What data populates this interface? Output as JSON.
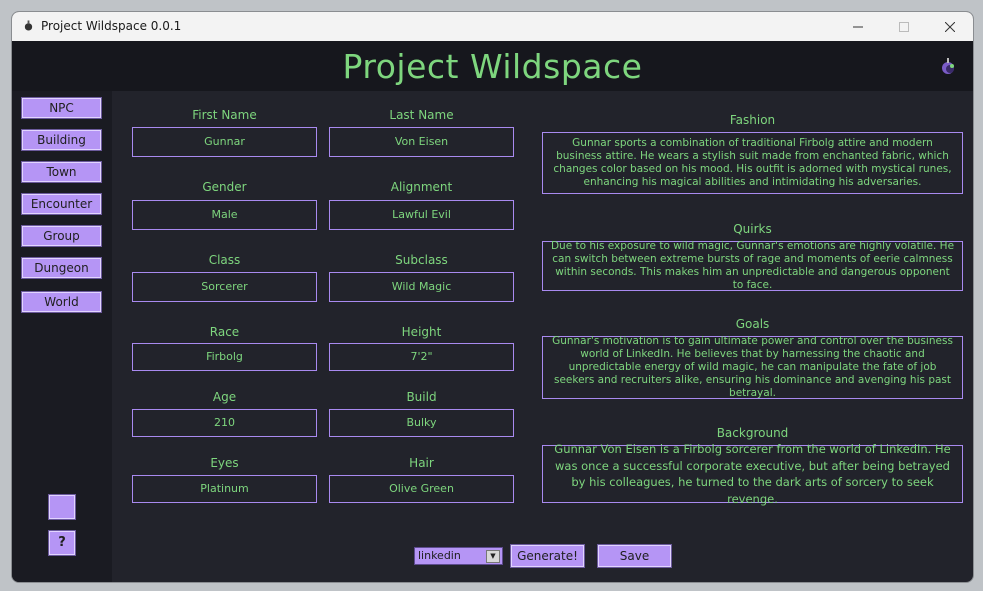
{
  "window": {
    "title": "Project Wildspace 0.0.1"
  },
  "header": {
    "title": "Project Wildspace"
  },
  "sidebar": {
    "items": [
      {
        "label": "NPC"
      },
      {
        "label": "Building"
      },
      {
        "label": "Town"
      },
      {
        "label": "Encounter"
      },
      {
        "label": "Group"
      },
      {
        "label": "Dungeon"
      },
      {
        "label": "World"
      }
    ],
    "help_label": "?"
  },
  "fields": {
    "first_name": {
      "label": "First Name",
      "value": "Gunnar"
    },
    "last_name": {
      "label": "Last Name",
      "value": "Von Eisen"
    },
    "gender": {
      "label": "Gender",
      "value": "Male"
    },
    "alignment": {
      "label": "Alignment",
      "value": "Lawful Evil"
    },
    "class": {
      "label": "Class",
      "value": "Sorcerer"
    },
    "subclass": {
      "label": "Subclass",
      "value": "Wild Magic"
    },
    "race": {
      "label": "Race",
      "value": "Firbolg"
    },
    "height": {
      "label": "Height",
      "value": "7'2\""
    },
    "age": {
      "label": "Age",
      "value": "210"
    },
    "build": {
      "label": "Build",
      "value": "Bulky"
    },
    "eyes": {
      "label": "Eyes",
      "value": "Platinum"
    },
    "hair": {
      "label": "Hair",
      "value": "Olive Green"
    }
  },
  "sections": {
    "fashion": {
      "label": "Fashion",
      "text": "Gunnar sports a combination of traditional Firbolg attire and modern business attire. He wears a stylish suit made from enchanted fabric, which changes color based on his mood. His outfit is adorned with mystical runes, enhancing his magical abilities and intimidating his adversaries."
    },
    "quirks": {
      "label": "Quirks",
      "text": "Due to his exposure to wild magic, Gunnar's emotions are highly volatile. He can switch between extreme bursts of rage and moments of eerie calmness within seconds. This makes him an unpredictable and dangerous opponent to face."
    },
    "goals": {
      "label": "Goals",
      "text": "Gunnar's motivation is to gain ultimate power and control over the business world of LinkedIn. He believes that by harnessing the chaotic and unpredictable energy of wild magic, he can manipulate the fate of job seekers and recruiters alike, ensuring his dominance and avenging his past betrayal."
    },
    "background": {
      "label": "Background",
      "text": "Gunnar Von Eisen is a Firbolg sorcerer from the world of LinkedIn. He was once a successful corporate executive, but after being betrayed by his colleagues, he turned to the dark arts of sorcery to seek revenge."
    }
  },
  "footer": {
    "dropdown_value": "linkedin",
    "generate_label": "Generate!",
    "save_label": "Save"
  },
  "colors": {
    "accent": "#b595f5",
    "text": "#7ed67e",
    "background": "#22232b"
  }
}
